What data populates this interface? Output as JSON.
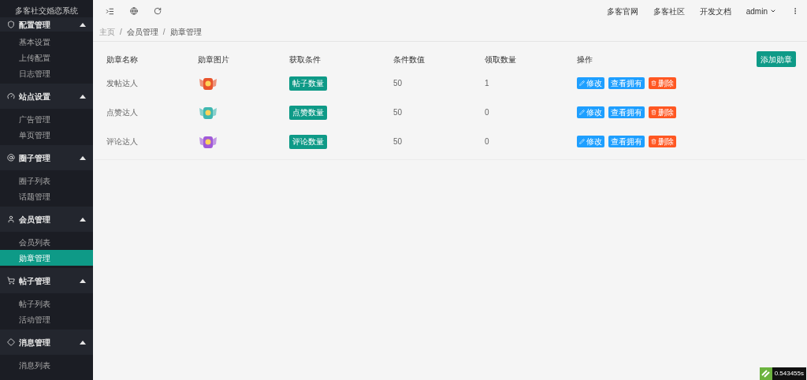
{
  "app_title": "多客社交婚恋系统",
  "sidebar": {
    "groups": [
      {
        "label": "配置管理",
        "expanded": true,
        "items": [
          {
            "label": "基本设置",
            "selected": false
          },
          {
            "label": "上传配置",
            "selected": false
          },
          {
            "label": "日志管理",
            "selected": false
          }
        ]
      },
      {
        "label": "站点设置",
        "expanded": true,
        "items": [
          {
            "label": "广告管理",
            "selected": false
          },
          {
            "label": "单页管理",
            "selected": false
          }
        ]
      },
      {
        "label": "圈子管理",
        "expanded": true,
        "items": [
          {
            "label": "圈子列表",
            "selected": false
          },
          {
            "label": "话题管理",
            "selected": false
          }
        ]
      },
      {
        "label": "会员管理",
        "expanded": true,
        "items": [
          {
            "label": "会员列表",
            "selected": false
          },
          {
            "label": "勋章管理",
            "selected": true
          }
        ]
      },
      {
        "label": "帖子管理",
        "expanded": true,
        "items": [
          {
            "label": "帖子列表",
            "selected": false
          },
          {
            "label": "活动管理",
            "selected": false
          }
        ]
      },
      {
        "label": "消息管理",
        "expanded": true,
        "items": [
          {
            "label": "消息列表",
            "selected": false
          }
        ]
      }
    ]
  },
  "top_links": [
    "多客官网",
    "多客社区",
    "开发文档"
  ],
  "user": "admin",
  "breadcrumb": [
    {
      "label": "主页"
    },
    {
      "separator": "/",
      "label": "会员管理"
    },
    {
      "separator": "/",
      "label": "勋章管理"
    }
  ],
  "table": {
    "columns": [
      "勋章名称",
      "勋章图片",
      "获取条件",
      "条件数值",
      "领取数量",
      "操作"
    ],
    "add_button": "添加勋章",
    "rows": [
      {
        "name": "发帖达人",
        "color": "#e8542c",
        "condition": "帖子数量",
        "value": "50",
        "claimed": "1",
        "actions": [
          "修改",
          "查看拥有",
          "删除"
        ]
      },
      {
        "name": "点赞达人",
        "color": "#3fb7b0",
        "condition": "点赞数量",
        "value": "50",
        "claimed": "0",
        "actions": [
          "修改",
          "查看拥有",
          "删除"
        ]
      },
      {
        "name": "评论达人",
        "color": "#a05ad8",
        "condition": "评论数量",
        "value": "50",
        "claimed": "0",
        "actions": [
          "修改",
          "查看拥有",
          "删除"
        ]
      }
    ]
  },
  "timer": "0.543455s"
}
